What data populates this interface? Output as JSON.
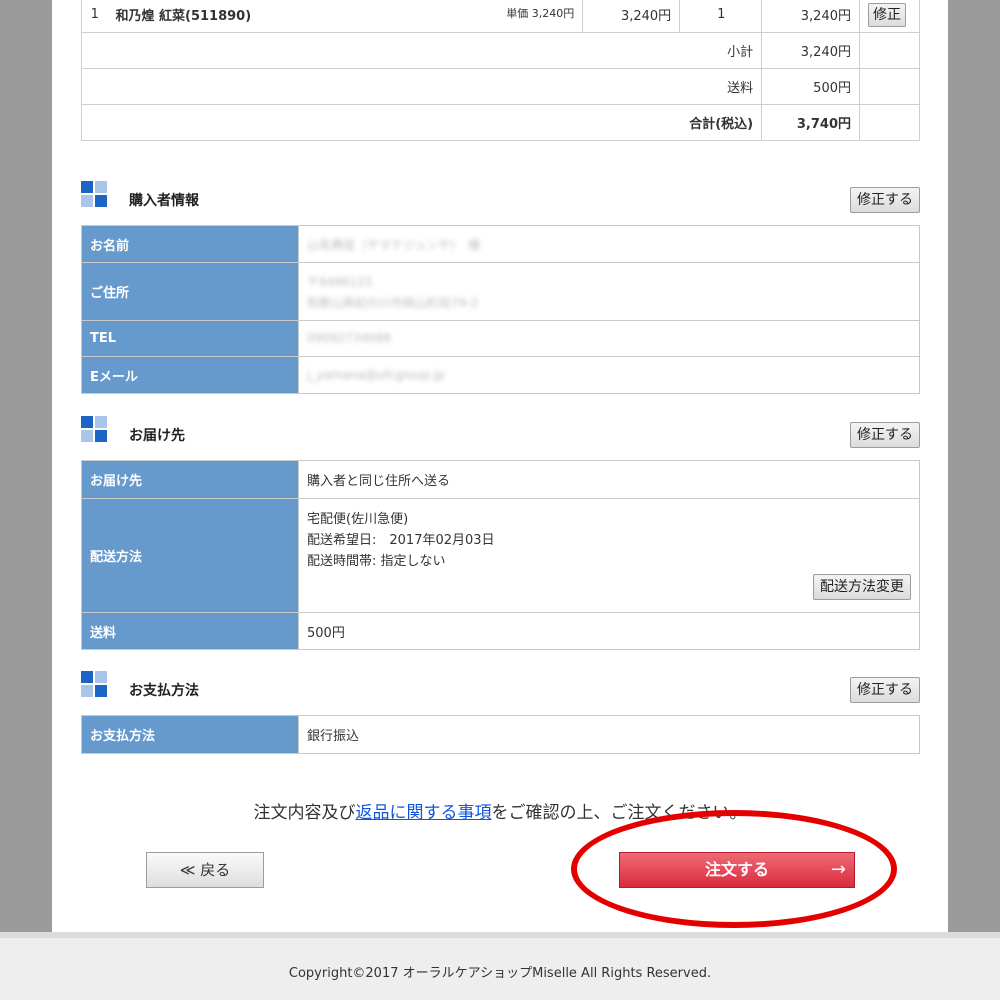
{
  "cart": {
    "row": {
      "index": "1",
      "name": "和乃煌 紅菜(511890)",
      "unit_price": "単価 3,240円",
      "price": "3,240円",
      "qty": "1",
      "amount": "3,240円",
      "edit_label": "修正"
    },
    "subtotal_label": "小計",
    "subtotal": "3,240円",
    "shipping_label": "送料",
    "shipping": "500円",
    "total_label": "合計(税込)",
    "total": "3,740円"
  },
  "buyer": {
    "title": "購入者情報",
    "edit_label": "修正する",
    "rows": [
      {
        "label": "お名前",
        "value": "山名典佳（ヤマナジュンヤ）　様"
      },
      {
        "label": "ご住所",
        "value": "〒6496125",
        "value2": "和歌山県紀の川市桃山町段79-2"
      },
      {
        "label": "TEL",
        "value": "09092734688"
      },
      {
        "label": "Eメール",
        "value": "j_yamana@ufcgroup.jp"
      }
    ]
  },
  "delivery": {
    "title": "お届け先",
    "edit_label": "修正する",
    "dest_label": "お届け先",
    "dest_value": "購入者と同じ住所へ送る",
    "method_label": "配送方法",
    "method_lines": [
      "宅配便(佐川急便)",
      "配送希望日:　2017年02月03日",
      "配送時間帯: 指定しない"
    ],
    "change_label": "配送方法変更",
    "fee_label": "送料",
    "fee_value": "500円"
  },
  "payment": {
    "title": "お支払方法",
    "edit_label": "修正する",
    "label": "お支払方法",
    "value": "銀行振込"
  },
  "notice": {
    "prefix": "注文内容及び",
    "link": "返品に関する事項",
    "suffix": "をご確認の上、ご注文ください。"
  },
  "actions": {
    "back_label": "≪ 戻る",
    "order_label": "注文する",
    "order_arrow": "→"
  },
  "footer": {
    "copyright": "Copyright©2017 オーラルケアショップMiselle All Rights Reserved."
  },
  "colors": {
    "header_blue": "#6699cc",
    "order_red": "#e04050",
    "highlight_circle": "#e50000"
  },
  "icons": [
    "section-squares-icon",
    "arrow-right-icon"
  ]
}
